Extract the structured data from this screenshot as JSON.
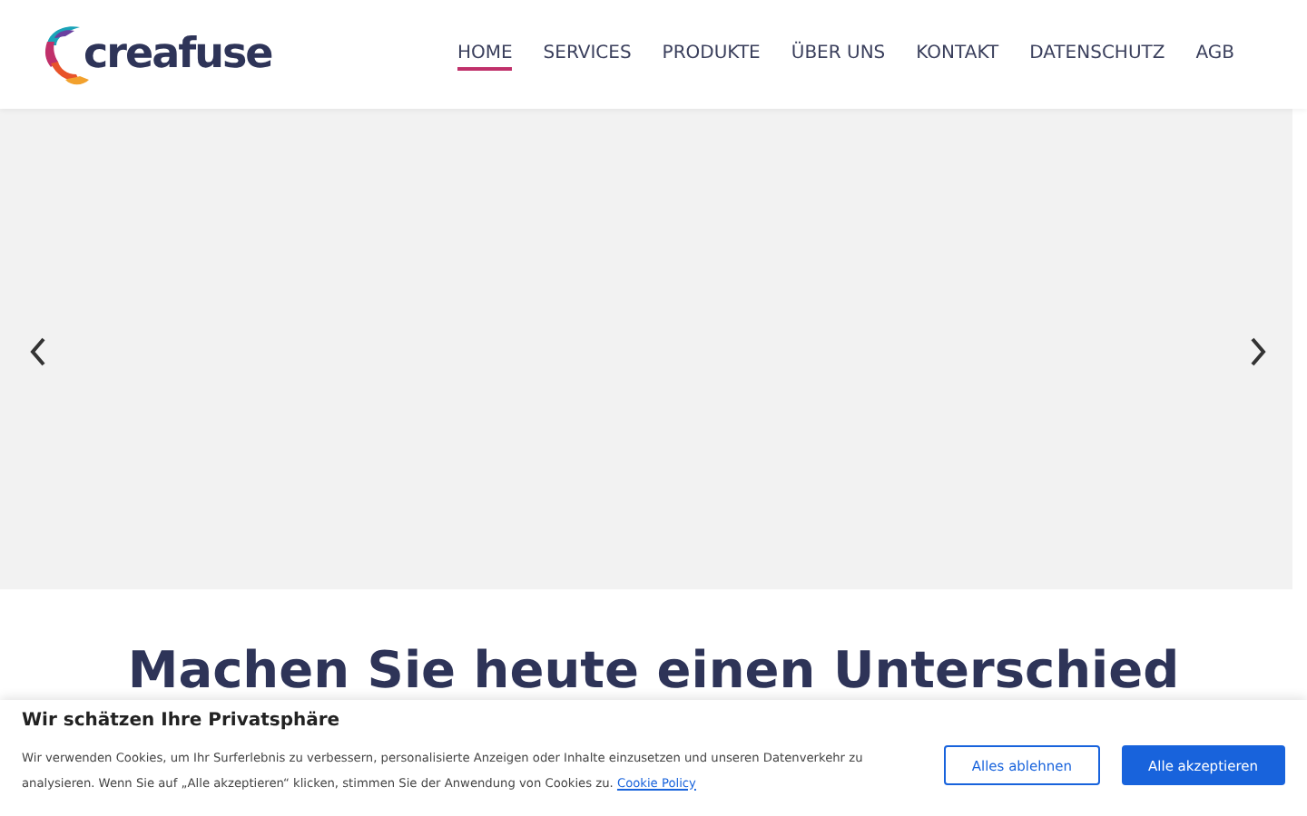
{
  "header": {
    "logo": "creafuse",
    "nav": [
      {
        "label": "HOME",
        "selected": true
      },
      {
        "label": "SERVICES",
        "selected": false
      },
      {
        "label": "PRODUKTE",
        "selected": false
      },
      {
        "label": "ÜBER UNS",
        "selected": false
      },
      {
        "label": "KONTAKT",
        "selected": false
      },
      {
        "label": "DATENSCHUTZ",
        "selected": false
      },
      {
        "label": "AGB",
        "selected": false
      }
    ]
  },
  "heading": "Machen Sie heute einen Unterschied",
  "cookie_banner": {
    "title": "Wir schätzen Ihre Privatsphäre",
    "text": "Wir verwenden Cookies, um Ihr Surferlebnis zu verbessern, personalisierte Anzeigen oder Inhalte einzusetzen und unseren Datenverkehr zu analysieren. Wenn Sie auf „Alle akzeptieren“ klicken, stimmen Sie der Anwendung von Cookies zu.",
    "link": "Cookie Policy",
    "buttons": [
      {
        "label": "Alles ablehnen",
        "kind": "secondary"
      },
      {
        "label": "Alle akzeptieren",
        "kind": "primary"
      }
    ]
  }
}
